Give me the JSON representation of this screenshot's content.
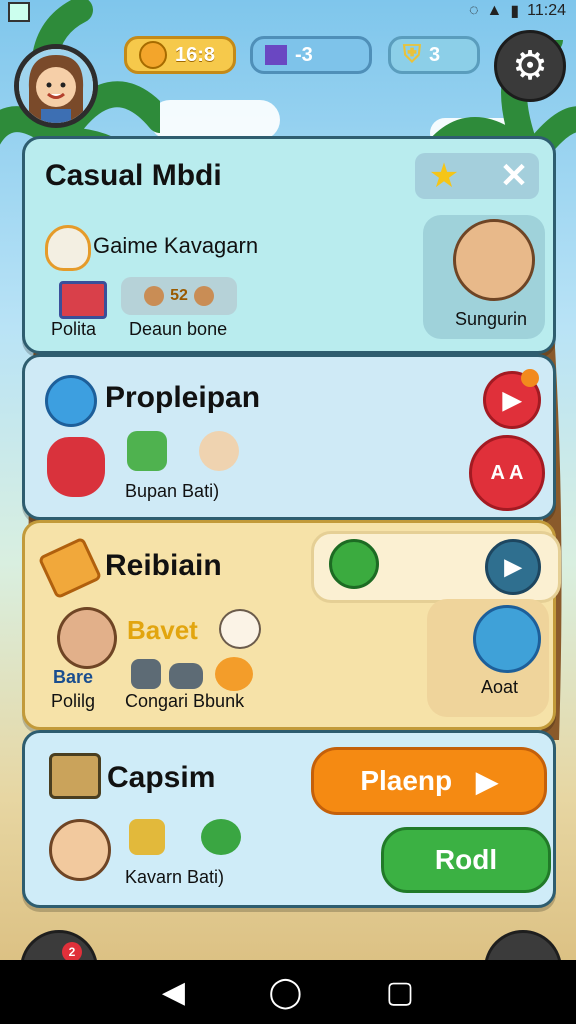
{
  "status_bar": {
    "time": "11:24"
  },
  "top_bar": {
    "coins": "16:8",
    "gems": "-3",
    "shields": "3"
  },
  "cards": [
    {
      "title": "Casual Mbdi",
      "subtitle": "Gaime Kavagarn",
      "item1": "Polita",
      "item2_badge": "52",
      "item2": "Deaun bone",
      "feature_label": "Sungurin"
    },
    {
      "title": "Propleipan",
      "items_label": "Bupan Bati)",
      "button2_label": "A A"
    },
    {
      "title": "Reibiain",
      "yellow_label": "Bavet",
      "badge_label": "Bare",
      "item1": "Polilg",
      "item2": "Congari Bbunk",
      "feature_label": "Aoat"
    },
    {
      "title": "Capsim",
      "items_label": "Kavarn Bati)",
      "play_label": "Plaenp",
      "green_label": "Rodl"
    }
  ],
  "notification_count": "2",
  "colors": {
    "orange_button": "#f58a12",
    "green_button": "#3bb143",
    "red_button": "#e0303a",
    "teal_button": "#2f6f8f"
  }
}
